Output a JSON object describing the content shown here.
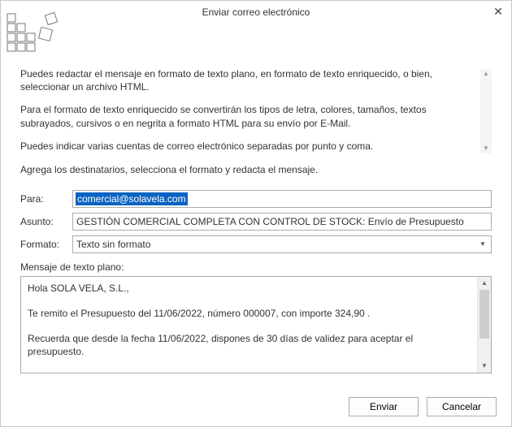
{
  "window": {
    "title": "Enviar correo electrónico"
  },
  "intro": {
    "p1": "Puedes redactar el mensaje en formato de texto plano, en formato de texto enriquecido, o bien, seleccionar un archivo HTML.",
    "p2": "Para el formato de texto enriquecido se convertirán los tipos de letra, colores, tamaños, textos subrayados, cursivos o en negrita a formato HTML para su envío por E-Mail.",
    "p3": "Puedes indicar varias cuentas de correo electrónico separadas por punto y coma."
  },
  "recipients_hint": "Agrega los destinatarios, selecciona el formato y redacta el mensaje.",
  "labels": {
    "to": "Para:",
    "subject": "Asunto:",
    "format": "Formato:",
    "message": "Mensaje de texto plano:"
  },
  "fields": {
    "to": "comercial@solavela.com",
    "subject": "GESTIÓN COMERCIAL COMPLETA CON CONTROL DE STOCK: Envío de Presupuesto",
    "format": "Texto sin formato"
  },
  "message": "Hola SOLA VELA, S.L.,\n\nTe remito el Presupuesto del 11/06/2022, número 000007, con importe 324,90 .\n\nRecuerda que desde la fecha 11/06/2022, dispones de 30 días de validez para aceptar el presupuesto.\n\nRecibe un cordial saludo de parte de todo nuestro equipo de ventas.\n\nEMPRESA DE DEMOSTRACIÓN S.L",
  "buttons": {
    "send": "Enviar",
    "cancel": "Cancelar"
  }
}
